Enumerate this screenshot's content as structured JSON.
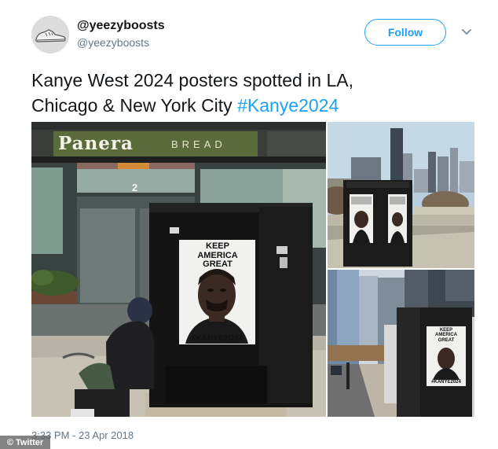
{
  "user": {
    "display_name": "@yeezyboosts",
    "handle": "@yeezyboosts",
    "avatar_icon": "sneaker-icon"
  },
  "follow_button": {
    "label": "Follow"
  },
  "more_menu": {
    "icon": "chevron-down-icon"
  },
  "tweet": {
    "text_line1": "Kanye West 2024 posters spotted in LA,",
    "text_line2_prefix": "Chicago & New York City ",
    "hashtag": "#Kanye2024"
  },
  "media": {
    "la_photo": {
      "storefront_sign": "Panera",
      "storefront_sign_2": "BREAD",
      "address_number": "2",
      "poster_slogan": "KEEP AMERICA GREAT",
      "poster_hashtag": "#KANYE2O24"
    },
    "chicago_photo": {},
    "ny_photo": {
      "poster_slogan": "KEEP AMERICA GREAT",
      "poster_hashtag": "#KANYE2024"
    }
  },
  "footer": {
    "timestamp": "3:33 PM - 23 Apr 2018",
    "watermark": "© Twitter"
  },
  "colors": {
    "link": "#1da1f2",
    "text": "#14171a",
    "secondary": "#657786"
  }
}
